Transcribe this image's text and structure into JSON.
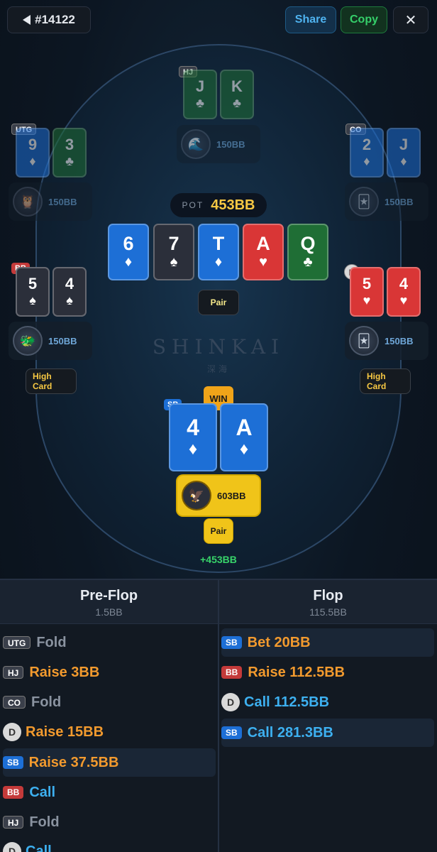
{
  "header": {
    "hand_id": "#14122",
    "share_label": "Share",
    "copy_label": "Copy",
    "close_glyph": "✕"
  },
  "table": {
    "brand": "SHINKAI",
    "brand_sub": "深海",
    "pot_label": "POT",
    "pot_value": "453BB",
    "board": [
      {
        "rank": "6",
        "suit": "♦"
      },
      {
        "rank": "7",
        "suit": "♠"
      },
      {
        "rank": "T",
        "suit": "♦"
      },
      {
        "rank": "A",
        "suit": "♥"
      },
      {
        "rank": "Q",
        "suit": "♣"
      }
    ],
    "board_hand": "Pair"
  },
  "players": {
    "hj": {
      "pos": "HJ",
      "cards": [
        {
          "rank": "J",
          "suit": "♣"
        },
        {
          "rank": "K",
          "suit": "♣"
        }
      ],
      "stack": "150BB",
      "avatar": "🌊"
    },
    "utg": {
      "pos": "UTG",
      "cards": [
        {
          "rank": "9",
          "suit": "♦"
        },
        {
          "rank": "3",
          "suit": "♣"
        }
      ],
      "stack": "150BB",
      "avatar": "🦉"
    },
    "co": {
      "pos": "CO",
      "cards": [
        {
          "rank": "2",
          "suit": "♦"
        },
        {
          "rank": "J",
          "suit": "♦"
        }
      ],
      "stack": "150BB",
      "avatar": "🃏"
    },
    "bb": {
      "pos": "BB",
      "cards": [
        {
          "rank": "5",
          "suit": "♠"
        },
        {
          "rank": "4",
          "suit": "♠"
        }
      ],
      "stack": "150BB",
      "avatar": "🐲",
      "hand": "High Card"
    },
    "btn": {
      "pos": "D",
      "cards": [
        {
          "rank": "5",
          "suit": "♥"
        },
        {
          "rank": "4",
          "suit": "♥"
        }
      ],
      "stack": "150BB",
      "avatar": "🃏",
      "hand": "High Card"
    },
    "sb": {
      "pos": "SB",
      "cards": [
        {
          "rank": "4",
          "suit": "♦"
        },
        {
          "rank": "A",
          "suit": "♦"
        }
      ],
      "stack": "603BB",
      "avatar": "🦅",
      "hand": "Pair",
      "result": "WIN",
      "gain": "+453BB"
    }
  },
  "streets": [
    {
      "name": "Pre-Flop",
      "pot": "1.5BB",
      "actions": [
        {
          "pos": "UTG",
          "text": "Fold"
        },
        {
          "pos": "HJ",
          "text": "Raise 3BB"
        },
        {
          "pos": "CO",
          "text": "Fold"
        },
        {
          "pos": "D",
          "text": "Raise 15BB"
        },
        {
          "pos": "SB",
          "text": "Raise 37.5BB"
        },
        {
          "pos": "BB",
          "text": "Call"
        },
        {
          "pos": "HJ",
          "text": "Fold"
        },
        {
          "pos": "D",
          "text": "Call"
        }
      ]
    },
    {
      "name": "Flop",
      "pot": "115.5BB",
      "actions": [
        {
          "pos": "SB",
          "text": "Bet 20BB"
        },
        {
          "pos": "BB",
          "text": "Raise 112.5BB"
        },
        {
          "pos": "D",
          "text": "Call 112.5BB"
        },
        {
          "pos": "SB",
          "text": "Call 281.3BB"
        }
      ]
    }
  ]
}
